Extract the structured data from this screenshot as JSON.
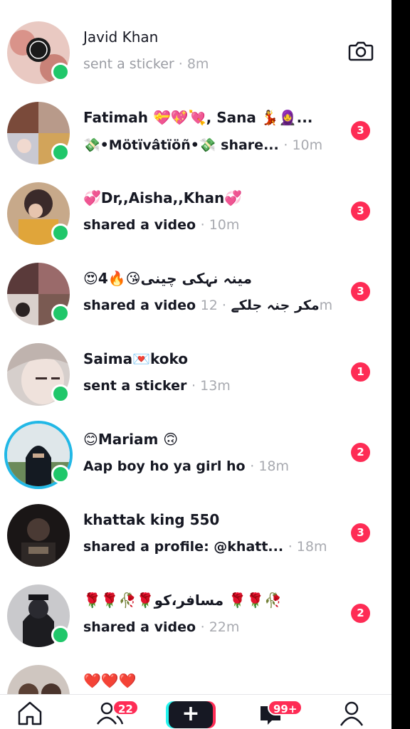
{
  "conversations": [
    {
      "name": "Javid Khan",
      "preview": "sent a sticker",
      "time": "· 8m",
      "badge": "",
      "has_camera": true
    },
    {
      "name": "Fatimah 💝💖💘, Sana 💃🧕...",
      "preview": "💸•Mötïvâtïöñ•💸 share...",
      "time": "· 10m",
      "badge": "3"
    },
    {
      "name": "💞Dr,,Aisha,,Khan💞",
      "preview": "shared a video",
      "time": "· 10m",
      "badge": "3"
    },
    {
      "name": "😍مینہ نہکی چینی😘🔥4",
      "preview": "shared a video مکر جنہ جلکے",
      "time": "· 12m",
      "badge": "3"
    },
    {
      "name": "Saima💌koko",
      "preview": "sent a sticker",
      "time": "· 13m",
      "badge": "1"
    },
    {
      "name": "😊Mariam 🙃",
      "preview": "Aap boy ho ya girl ho",
      "time": "· 18m",
      "badge": "2"
    },
    {
      "name": "khattak king 550",
      "preview": "shared a profile: @khatt...",
      "time": "· 18m",
      "badge": "3"
    },
    {
      "name": "🌹🌹🥀🌹مسافر،کو 🌹🌹🥀",
      "preview": "shared a video",
      "time": "· 22m",
      "badge": "2"
    },
    {
      "name": "❤️❤️❤️",
      "preview": "",
      "time": "",
      "badge": ""
    }
  ],
  "tabbar": {
    "home_icon": "home-icon",
    "friends_icon": "friends-icon",
    "friends_badge": "22",
    "create_label": "+",
    "inbox_icon": "inbox-icon",
    "inbox_badge": "99+",
    "profile_icon": "profile-icon"
  },
  "colors": {
    "badge": "#fe2c55",
    "online": "#20c76a",
    "story_ring": "#22b8e6",
    "text": "#161823",
    "muted": "#a8aab0"
  }
}
